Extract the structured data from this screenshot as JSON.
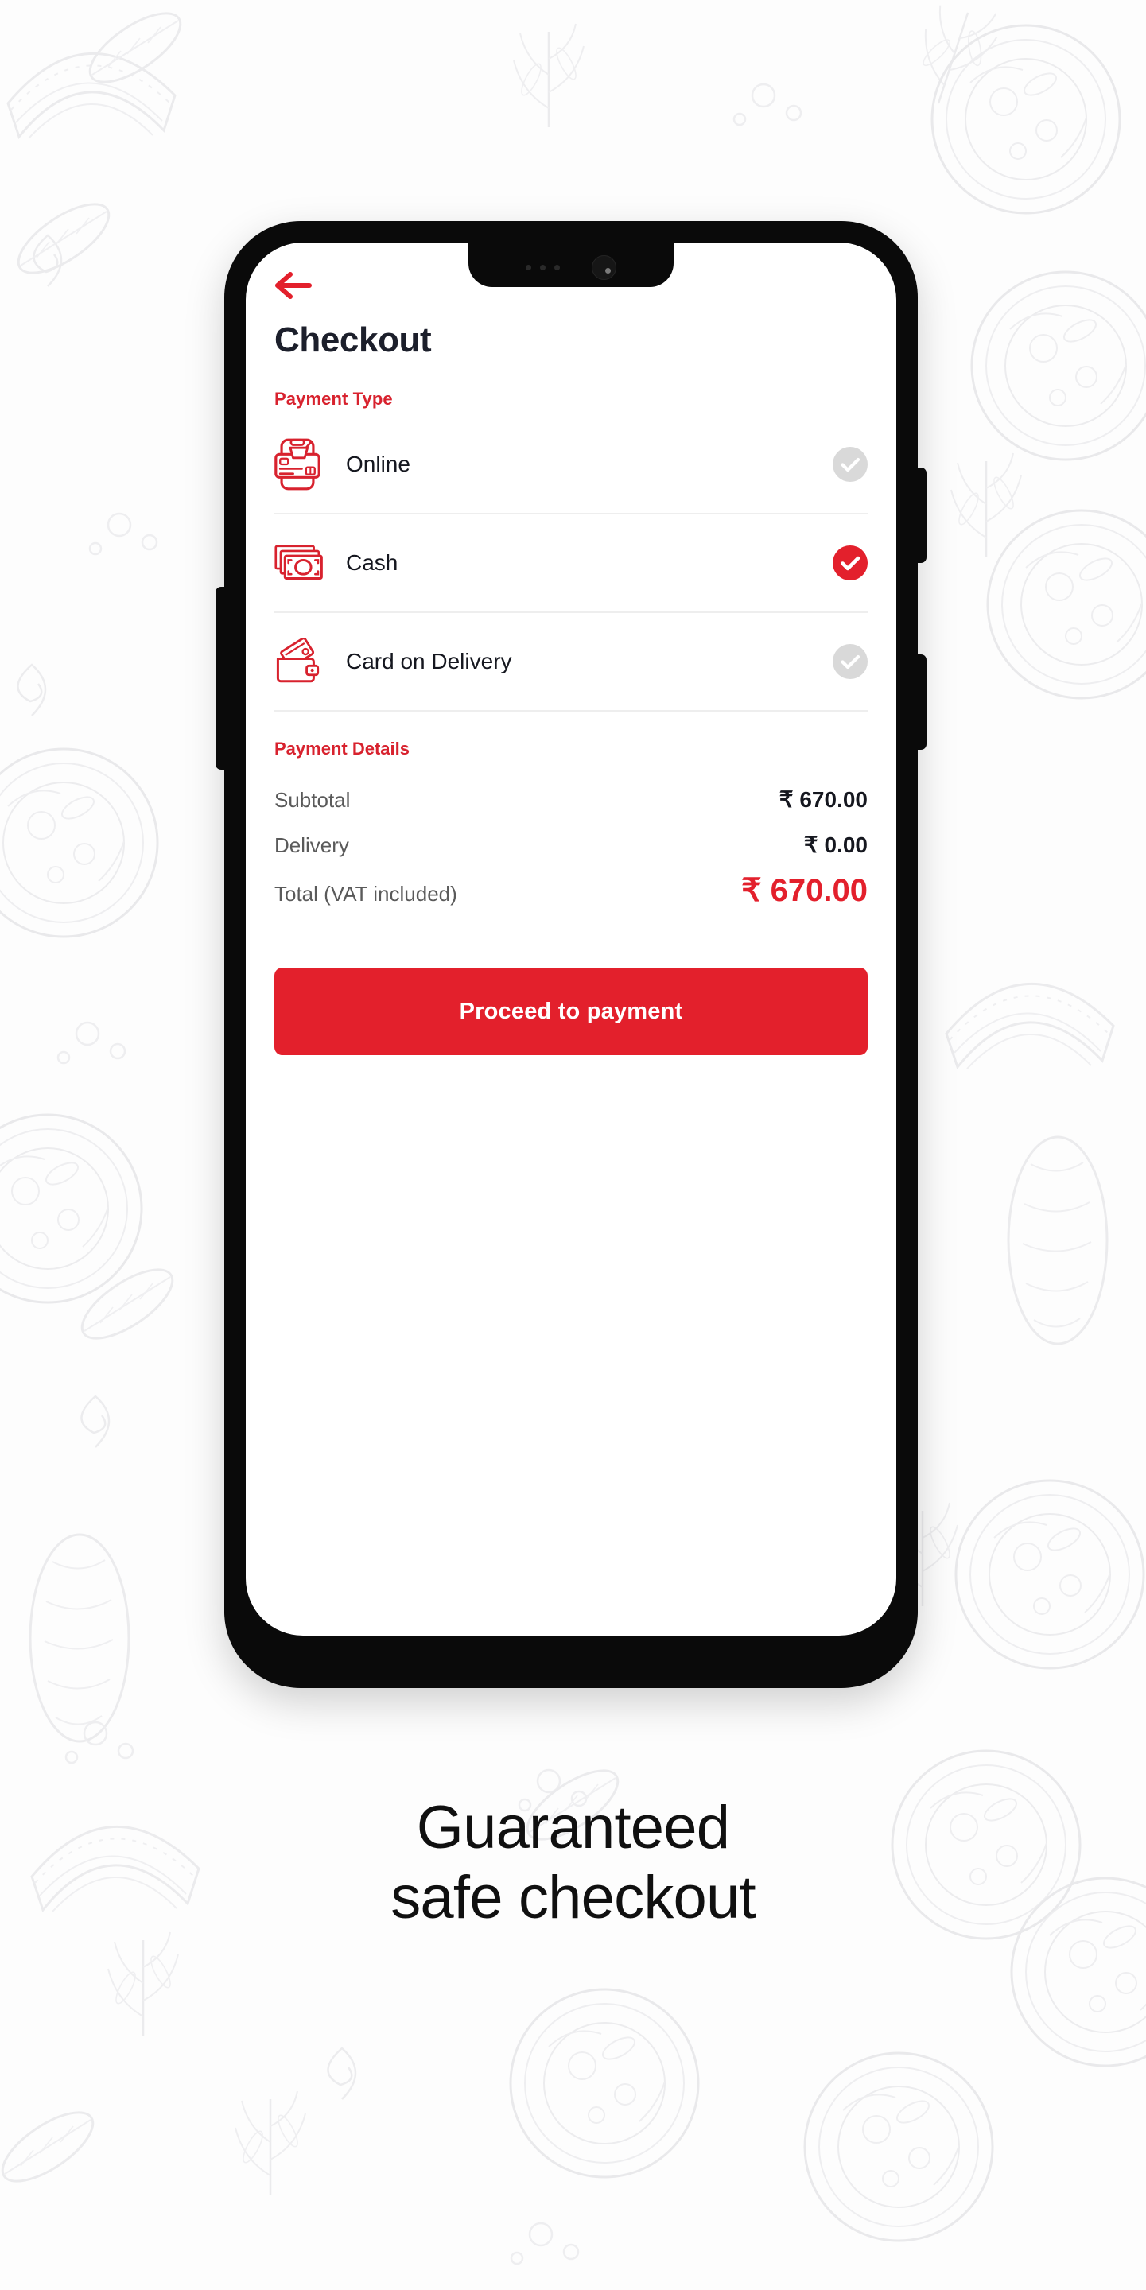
{
  "background": {
    "description": "faint food line-art illustration pattern",
    "color": "#f2f2f3"
  },
  "theme": {
    "brand_red": "#e3202c",
    "dark_text": "#15171f",
    "muted_text": "#5a5a5a",
    "divider": "#eeeeee",
    "unselected_check": "#d9d9d9"
  },
  "device": {
    "frame_color": "#0a0a0a",
    "screen_bg": "#ffffff"
  },
  "app": {
    "back_icon": "arrow-left-icon",
    "title": "Checkout",
    "payment_type": {
      "label": "Payment Type",
      "options": [
        {
          "id": "online",
          "label": "Online",
          "icon": "mobile-card-payment-icon",
          "selected": false
        },
        {
          "id": "cash",
          "label": "Cash",
          "icon": "banknotes-icon",
          "selected": true
        },
        {
          "id": "card-on-delivery",
          "label": "Card on Delivery",
          "icon": "wallet-card-icon",
          "selected": false
        }
      ]
    },
    "payment_details": {
      "label": "Payment Details",
      "rows": [
        {
          "name": "Subtotal",
          "value": "₹ 670.00"
        },
        {
          "name": "Delivery",
          "value": "₹ 0.00"
        },
        {
          "name": "Total (VAT included)",
          "value": "₹ 670.00"
        }
      ]
    },
    "cta": {
      "label": "Proceed to payment"
    }
  },
  "caption": {
    "line1": "Guaranteed",
    "line2": "safe checkout"
  }
}
